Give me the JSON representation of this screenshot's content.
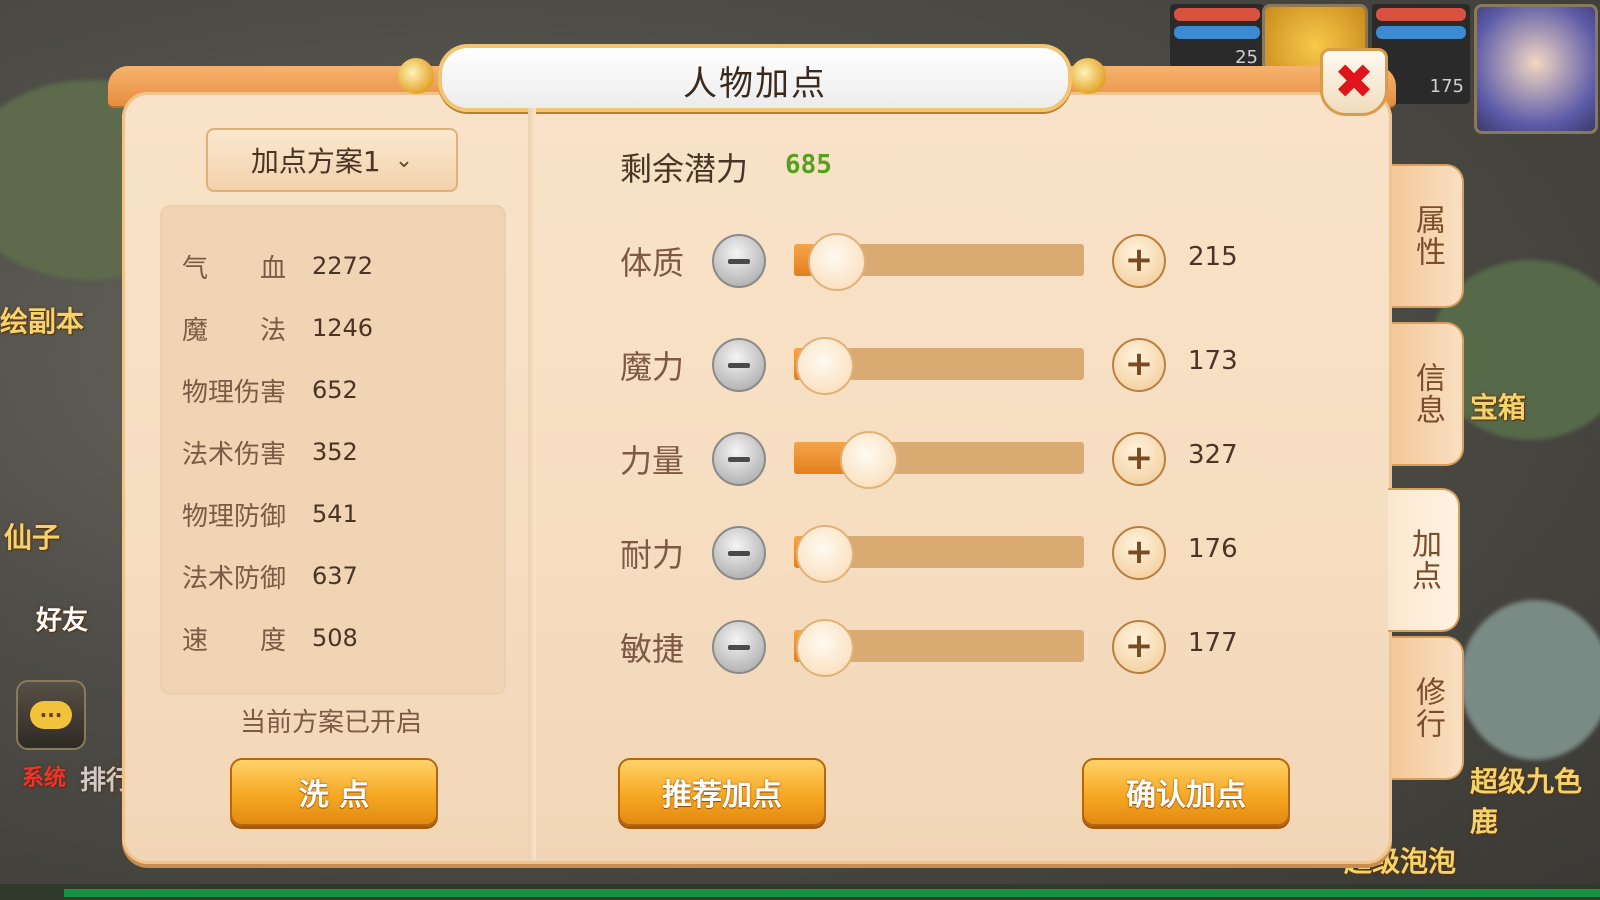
{
  "panel": {
    "title": "人物加点",
    "close_icon": "close-icon"
  },
  "plan": {
    "selected": "加点方案1",
    "status": "当前方案已开启"
  },
  "stats": [
    {
      "label": "气　　血",
      "value": "2272"
    },
    {
      "label": "魔　　法",
      "value": "1246"
    },
    {
      "label": "物理伤害",
      "value": "652"
    },
    {
      "label": "法术伤害",
      "value": "352"
    },
    {
      "label": "物理防御",
      "value": "541"
    },
    {
      "label": "法术防御",
      "value": "637"
    },
    {
      "label": "速　　度",
      "value": "508"
    }
  ],
  "potential": {
    "label": "剩余潜力",
    "value": "685"
  },
  "attributes": [
    {
      "label": "体质",
      "value": "215",
      "fill_fraction": 0.14
    },
    {
      "label": "魔力",
      "value": "173",
      "fill_fraction": 0.1
    },
    {
      "label": "力量",
      "value": "327",
      "fill_fraction": 0.25
    },
    {
      "label": "耐力",
      "value": "176",
      "fill_fraction": 0.1
    },
    {
      "label": "敏捷",
      "value": "177",
      "fill_fraction": 0.1
    }
  ],
  "buttons": {
    "reset": "洗 点",
    "recommend": "推荐加点",
    "confirm": "确认加点"
  },
  "side_tabs": [
    {
      "label": "属性",
      "active": false
    },
    {
      "label": "信息",
      "active": false
    },
    {
      "label": "加点",
      "active": true
    },
    {
      "label": "修行",
      "active": false
    }
  ],
  "background": {
    "left_labels": [
      "绘副本",
      "仙子",
      "好友",
      "系统",
      "排行"
    ],
    "right_labels": [
      "宝箱",
      "超级九色鹿",
      "超级泡泡"
    ],
    "hud_levels": [
      "25",
      "175"
    ]
  },
  "colors": {
    "accent_orange": "#e88e3f",
    "potential_green": "#54a11b",
    "close_red": "#e0141a"
  }
}
